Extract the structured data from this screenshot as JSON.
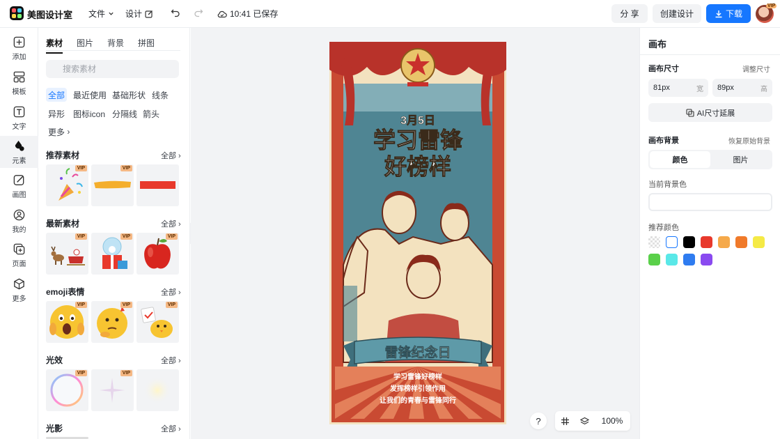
{
  "header": {
    "app_name": "美图设计室",
    "file_menu": "文件",
    "design_menu": "设计",
    "saved_status": "10:41 已保存",
    "share_label": "分 享",
    "create_label": "创建设计",
    "download_label": "下载",
    "avatar_badge": "VIP"
  },
  "nav": {
    "items": [
      {
        "label": "添加",
        "icon": "plus-square-icon"
      },
      {
        "label": "模板",
        "icon": "template-icon"
      },
      {
        "label": "文字",
        "icon": "text-icon"
      },
      {
        "label": "元素",
        "icon": "shapes-icon"
      },
      {
        "label": "画图",
        "icon": "draw-icon"
      },
      {
        "label": "我的",
        "icon": "user-icon"
      },
      {
        "label": "页面",
        "icon": "page-add-icon"
      },
      {
        "label": "更多",
        "icon": "cube-icon"
      }
    ],
    "active": "元素"
  },
  "panel": {
    "tabs": [
      "素材",
      "图片",
      "背景",
      "拼图"
    ],
    "active_tab": "素材",
    "search_placeholder": "搜索素材",
    "chips": [
      "全部",
      "最近使用",
      "基础形状",
      "线条",
      "异形",
      "图标icon",
      "分隔线",
      "箭头",
      "更多"
    ],
    "active_chip": "全部",
    "see_all": "全部",
    "sections": [
      {
        "title": "推荐素材",
        "items": [
          {
            "name": "party-popper-sticker",
            "vip": true
          },
          {
            "name": "yellow-brush-stroke",
            "vip": true
          },
          {
            "name": "red-bar-shape",
            "vip": false
          }
        ]
      },
      {
        "title": "最新素材",
        "items": [
          {
            "name": "reindeer-sleigh",
            "vip": true
          },
          {
            "name": "snow-globe-gift",
            "vip": true
          },
          {
            "name": "red-apple",
            "vip": true
          }
        ]
      },
      {
        "title": "emoji表情",
        "items": [
          {
            "name": "shocked-emoji",
            "vip": true
          },
          {
            "name": "thinking-emoji",
            "vip": true
          },
          {
            "name": "chick-emoji",
            "vip": true
          }
        ]
      },
      {
        "title": "光效",
        "items": [
          {
            "name": "bubble-ring",
            "vip": true
          },
          {
            "name": "sparkle-star",
            "vip": true
          },
          {
            "name": "soft-glow",
            "vip": false
          }
        ]
      },
      {
        "title": "光影",
        "items": []
      }
    ],
    "vip_badge": "VIP"
  },
  "poster": {
    "date": "3月5日",
    "headline_1": "学习雷锋",
    "headline_2": "好榜样",
    "ribbon": "雷锋纪念日",
    "line_1": "学习雷锋好榜样",
    "line_2": "发挥榜样引领作用",
    "line_3": "让我们的青春与雷锋同行"
  },
  "canvas_controls": {
    "help": "?",
    "zoom": "100%"
  },
  "right_panel": {
    "title": "画布",
    "size_label": "画布尺寸",
    "adjust_size": "调整尺寸",
    "width_value": "81px",
    "width_unit": "宽",
    "height_value": "89px",
    "height_unit": "高",
    "ai_extend": "AI尺寸延展",
    "bg_label": "画布背景",
    "restore_bg": "恢复原始背景",
    "seg_color": "颜色",
    "seg_image": "图片",
    "current_bg": "当前背景色",
    "recommend": "推荐颜色",
    "swatches": [
      "transparent",
      "#ffffff",
      "#000000",
      "#e8392c",
      "#f5a94a",
      "#f07a2a",
      "#f5ea46",
      "#5ad04a",
      "#5ae8e8",
      "#2f7cf0",
      "#8a4af0"
    ]
  }
}
